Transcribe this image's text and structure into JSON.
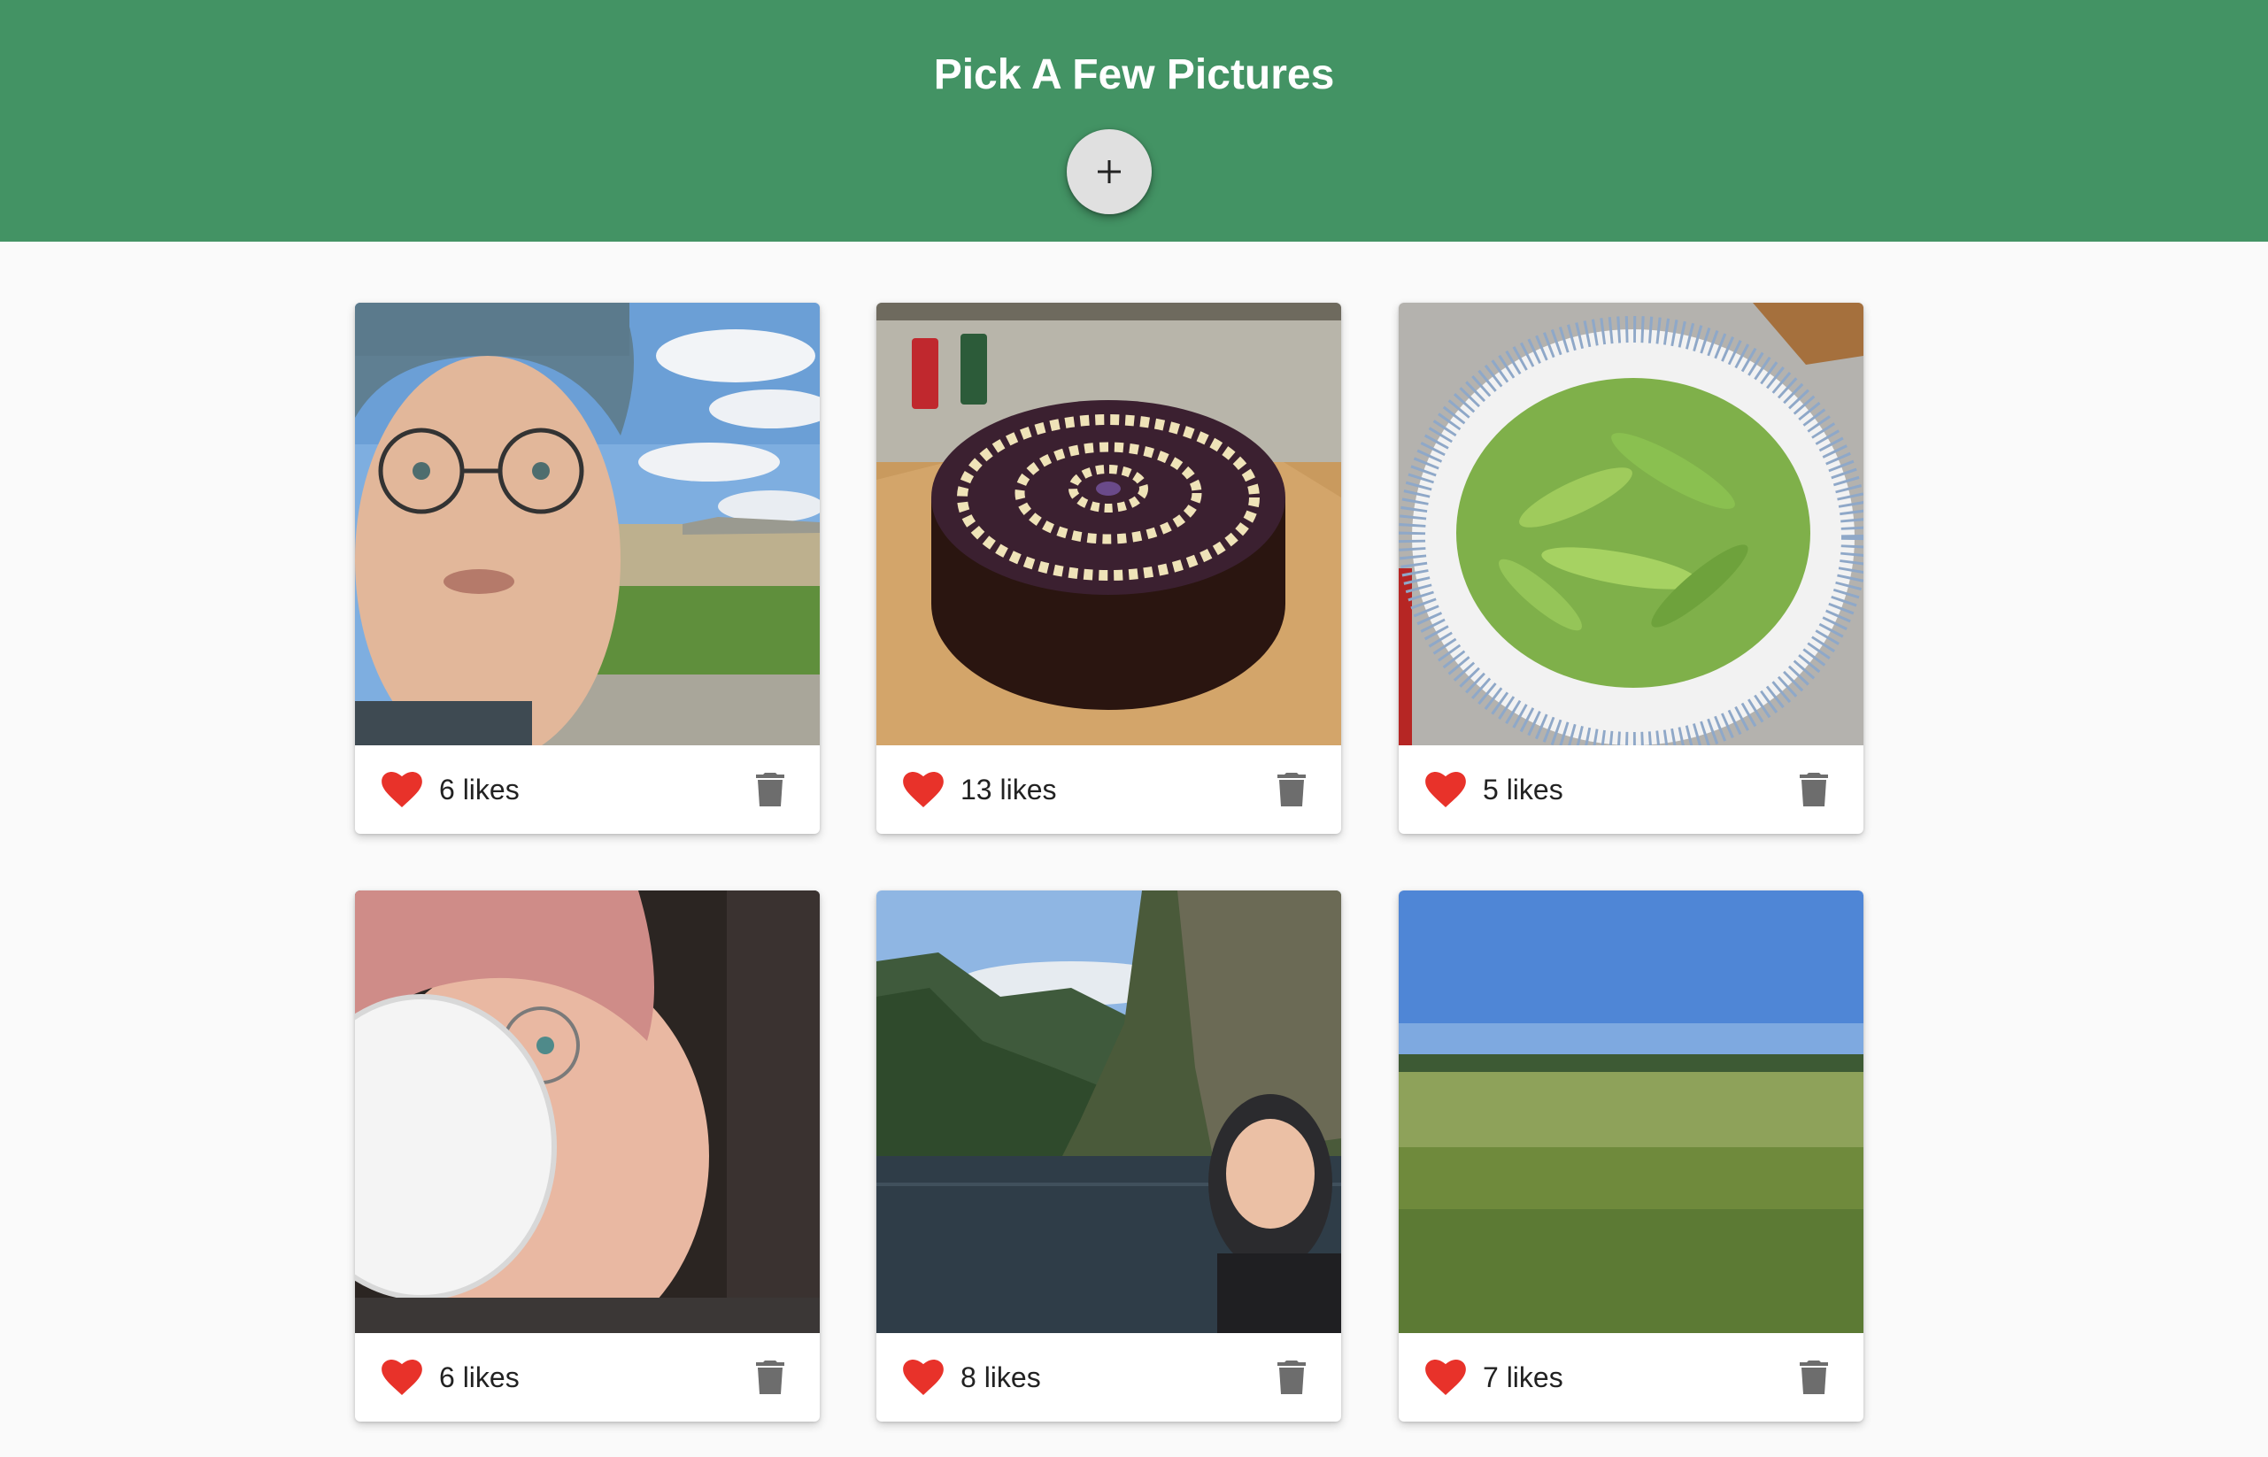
{
  "header": {
    "title": "Pick A Few Pictures",
    "add_icon": "plus-icon",
    "background_color": "#439364"
  },
  "pictures": [
    {
      "subject": "selfie with bike helmet",
      "likes_label": "6 likes",
      "likes": 6
    },
    {
      "subject": "chocolate cake",
      "likes_label": "13 likes",
      "likes": 13
    },
    {
      "subject": "bowl of edamame",
      "likes_label": "5 likes",
      "likes": 5
    },
    {
      "subject": "selfie drinking coffee",
      "likes_label": "6 likes",
      "likes": 6
    },
    {
      "subject": "fjord selfie",
      "likes_label": "8 likes",
      "likes": 8
    },
    {
      "subject": "meadow landscape",
      "likes_label": "7 likes",
      "likes": 7
    }
  ],
  "icons": {
    "like": "heart-icon",
    "delete": "trash-icon"
  },
  "colors": {
    "heart": "#e8322a",
    "trash": "#6d6d6d"
  }
}
